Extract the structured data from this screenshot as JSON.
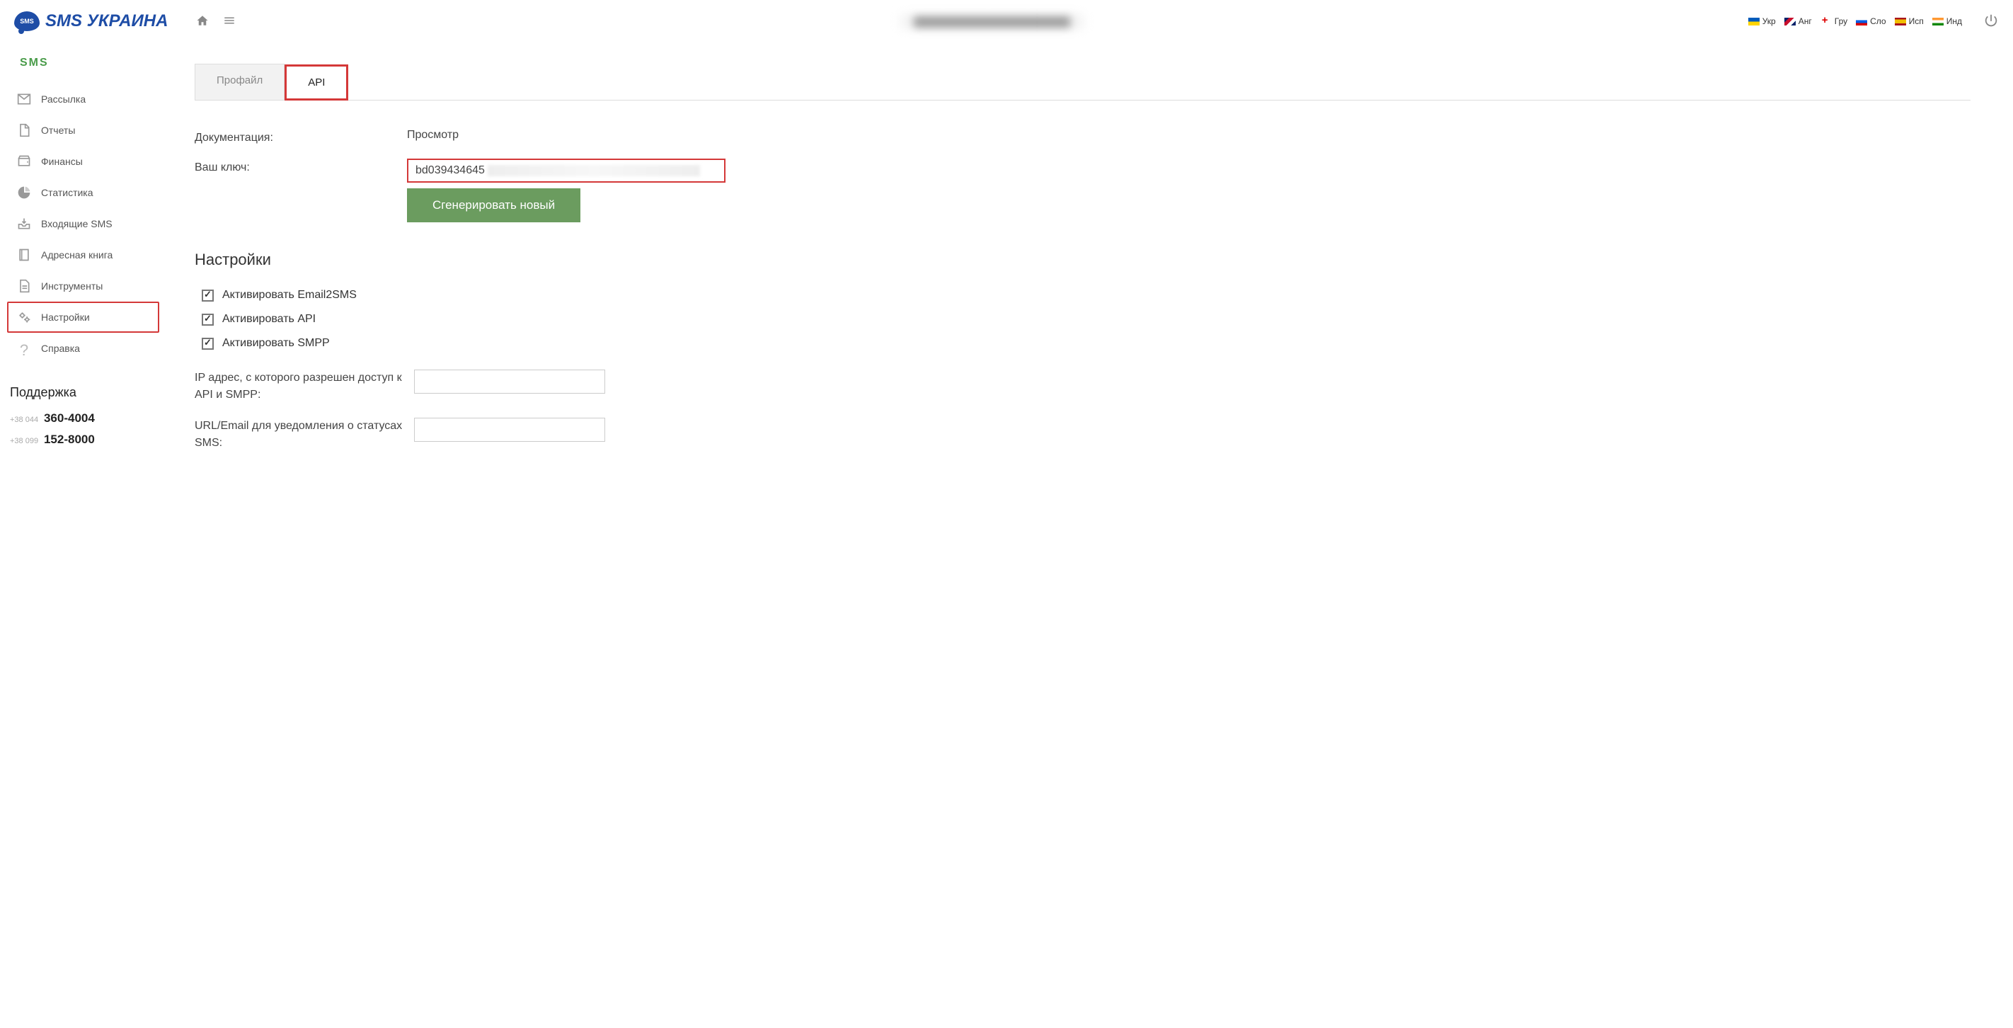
{
  "logo": {
    "bubble": "SMS",
    "text": "SMS УКРАИНА"
  },
  "langs": [
    {
      "code": "ua",
      "label": "Укр"
    },
    {
      "code": "gb",
      "label": "Анг"
    },
    {
      "code": "ge",
      "label": "Гру"
    },
    {
      "code": "sl",
      "label": "Сло"
    },
    {
      "code": "es",
      "label": "Исп"
    },
    {
      "code": "in",
      "label": "Инд"
    }
  ],
  "sidebar": {
    "title": "SMS",
    "items": [
      {
        "label": "Рассылка",
        "icon": "mail"
      },
      {
        "label": "Отчеты",
        "icon": "file"
      },
      {
        "label": "Финансы",
        "icon": "wallet"
      },
      {
        "label": "Статистика",
        "icon": "pie"
      },
      {
        "label": "Входящие SMS",
        "icon": "inbox"
      },
      {
        "label": "Адресная книга",
        "icon": "book"
      },
      {
        "label": "Инструменты",
        "icon": "doc"
      },
      {
        "label": "Настройки",
        "icon": "gears",
        "highlighted": true
      },
      {
        "label": "Справка",
        "icon": "help"
      }
    ]
  },
  "support": {
    "title": "Поддержка",
    "phones": [
      {
        "prefix": "+38 044",
        "num": "360-4004"
      },
      {
        "prefix": "+38 099",
        "num": "152-8000"
      }
    ]
  },
  "tabs": [
    {
      "label": "Профайл",
      "active": false
    },
    {
      "label": "API",
      "active": true,
      "highlighted": true
    }
  ],
  "api": {
    "doc_label": "Документация:",
    "doc_value": "Просмотр",
    "key_label": "Ваш ключ:",
    "key_value": "bd039434645",
    "generate_btn": "Сгенерировать новый"
  },
  "settings": {
    "title": "Настройки",
    "checkboxes": [
      {
        "label": "Активировать Email2SMS",
        "checked": true
      },
      {
        "label": "Активировать API",
        "checked": true
      },
      {
        "label": "Активировать SMPP",
        "checked": true
      }
    ],
    "ip_label": "IP адрес, с которого разрешен доступ к API и SMPP:",
    "ip_value": "",
    "url_label": "URL/Email для уведомления о статусах SMS:",
    "url_value": ""
  }
}
